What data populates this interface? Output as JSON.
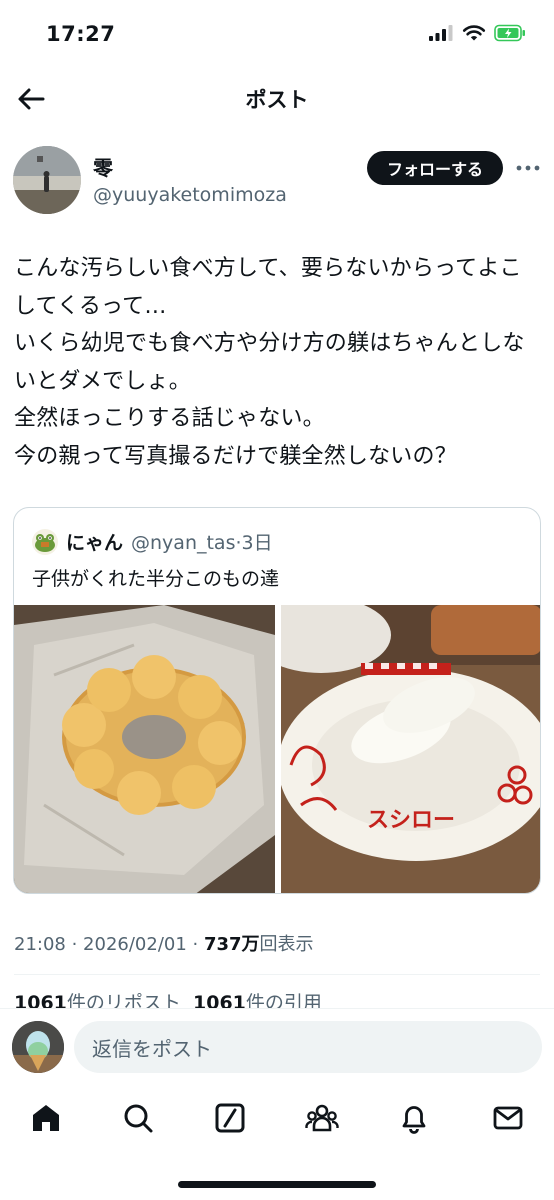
{
  "status_bar": {
    "time": "17:27"
  },
  "header": {
    "title": "ポスト"
  },
  "author": {
    "display_name": "零",
    "handle": "@yuuyaketomimoza",
    "follow_label": "フォローする"
  },
  "post": {
    "text": "こんな汚らしい食べ方して、要らないからってよこしてくるって…\nいくら幼児でも食べ方や分け方の躾はちゃんとしないとダメでしょ。\n全然ほっこりする話じゃない。\n今の親って写真撮るだけで躾全然しないの？"
  },
  "quote": {
    "name": "にゃん",
    "handle": "@nyan_tas",
    "sep": "·",
    "time": "3日",
    "text": "子供がくれた半分このもの達",
    "plate_text": "スシロー"
  },
  "meta": {
    "time": "21:08",
    "sep1": " · ",
    "date": "2026/02/01",
    "sep2": " · ",
    "views": "737万",
    "views_label": "回表示"
  },
  "stats": {
    "reposts": "1061",
    "reposts_label": "件のリポスト",
    "quotes": "1061",
    "quotes_label": "件の引用"
  },
  "reply": {
    "placeholder": "返信をポスト"
  },
  "tabs": [
    {
      "icon": "home-icon"
    },
    {
      "icon": "search-icon"
    },
    {
      "icon": "grok-icon"
    },
    {
      "icon": "communities-icon"
    },
    {
      "icon": "bell-icon"
    },
    {
      "icon": "mail-icon"
    }
  ],
  "colors": {
    "text": "#0f1419",
    "secondary": "#536471",
    "accent_red": "#c4211b",
    "battery": "#34c759"
  }
}
